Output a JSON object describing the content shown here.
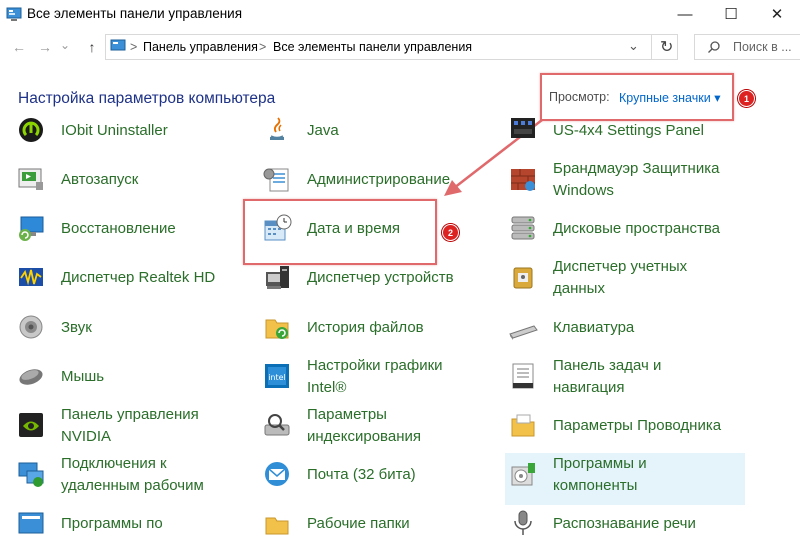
{
  "window": {
    "title": "Все элементы панели управления",
    "minimize": "—",
    "maximize": "☐",
    "close": "✕"
  },
  "address": {
    "back": "←",
    "forward": "→",
    "recent": "⌄",
    "up": "↑",
    "crumbs": [
      "Панель управления",
      "Все элементы панели управления"
    ],
    "separator": ">",
    "dropdown": "⌄",
    "refresh": "↻",
    "search_placeholder": "Поиск в ..."
  },
  "header": {
    "title": "Настройка параметров компьютера",
    "view_label": "Просмотр:",
    "view_value": "Крупные значки",
    "view_caret": "▾"
  },
  "badges": [
    "1",
    "2"
  ],
  "columns": [
    [
      {
        "label": "IObit Uninstaller",
        "icon": "iobit-icon"
      },
      {
        "label": "Автозапуск",
        "icon": "autoplay-icon"
      },
      {
        "label": "Восстановление",
        "icon": "recovery-icon"
      },
      {
        "label": "Диспетчер Realtek HD",
        "icon": "realtek-icon"
      },
      {
        "label": "Звук",
        "icon": "sound-icon"
      },
      {
        "label": "Мышь",
        "icon": "mouse-icon"
      },
      {
        "label": "Панель управления\nNVIDIA",
        "icon": "nvidia-icon"
      },
      {
        "label": "Подключения к\nудаленным рабочим",
        "icon": "remote-desktop-icon"
      },
      {
        "label": "Программы по",
        "icon": "default-programs-icon"
      }
    ],
    [
      {
        "label": "Java",
        "icon": "java-icon"
      },
      {
        "label": "Администрирование",
        "icon": "admin-tools-icon"
      },
      {
        "label": "Дата и время",
        "icon": "date-time-icon"
      },
      {
        "label": "Диспетчер устройств",
        "icon": "device-manager-icon"
      },
      {
        "label": "История файлов",
        "icon": "file-history-icon"
      },
      {
        "label": "Настройки графики\nIntel®",
        "icon": "intel-graphics-icon"
      },
      {
        "label": "Параметры\nиндексирования",
        "icon": "indexing-icon"
      },
      {
        "label": "Почта (32 бита)",
        "icon": "mail-icon"
      },
      {
        "label": "Рабочие папки",
        "icon": "work-folders-icon"
      }
    ],
    [
      {
        "label": "US-4x4 Settings Panel",
        "icon": "us4x4-icon"
      },
      {
        "label": "Брандмауэр Защитника\nWindows",
        "icon": "firewall-icon"
      },
      {
        "label": "Дисковые пространства",
        "icon": "storage-spaces-icon"
      },
      {
        "label": "Диспетчер учетных\nданных",
        "icon": "credential-manager-icon"
      },
      {
        "label": "Клавиатура",
        "icon": "keyboard-icon"
      },
      {
        "label": "Панель задач и\nнавигация",
        "icon": "taskbar-icon"
      },
      {
        "label": "Параметры Проводника",
        "icon": "explorer-options-icon"
      },
      {
        "label": "Программы и\nкомпоненты",
        "icon": "programs-features-icon"
      },
      {
        "label": "Распознавание речи",
        "icon": "speech-icon"
      }
    ]
  ]
}
